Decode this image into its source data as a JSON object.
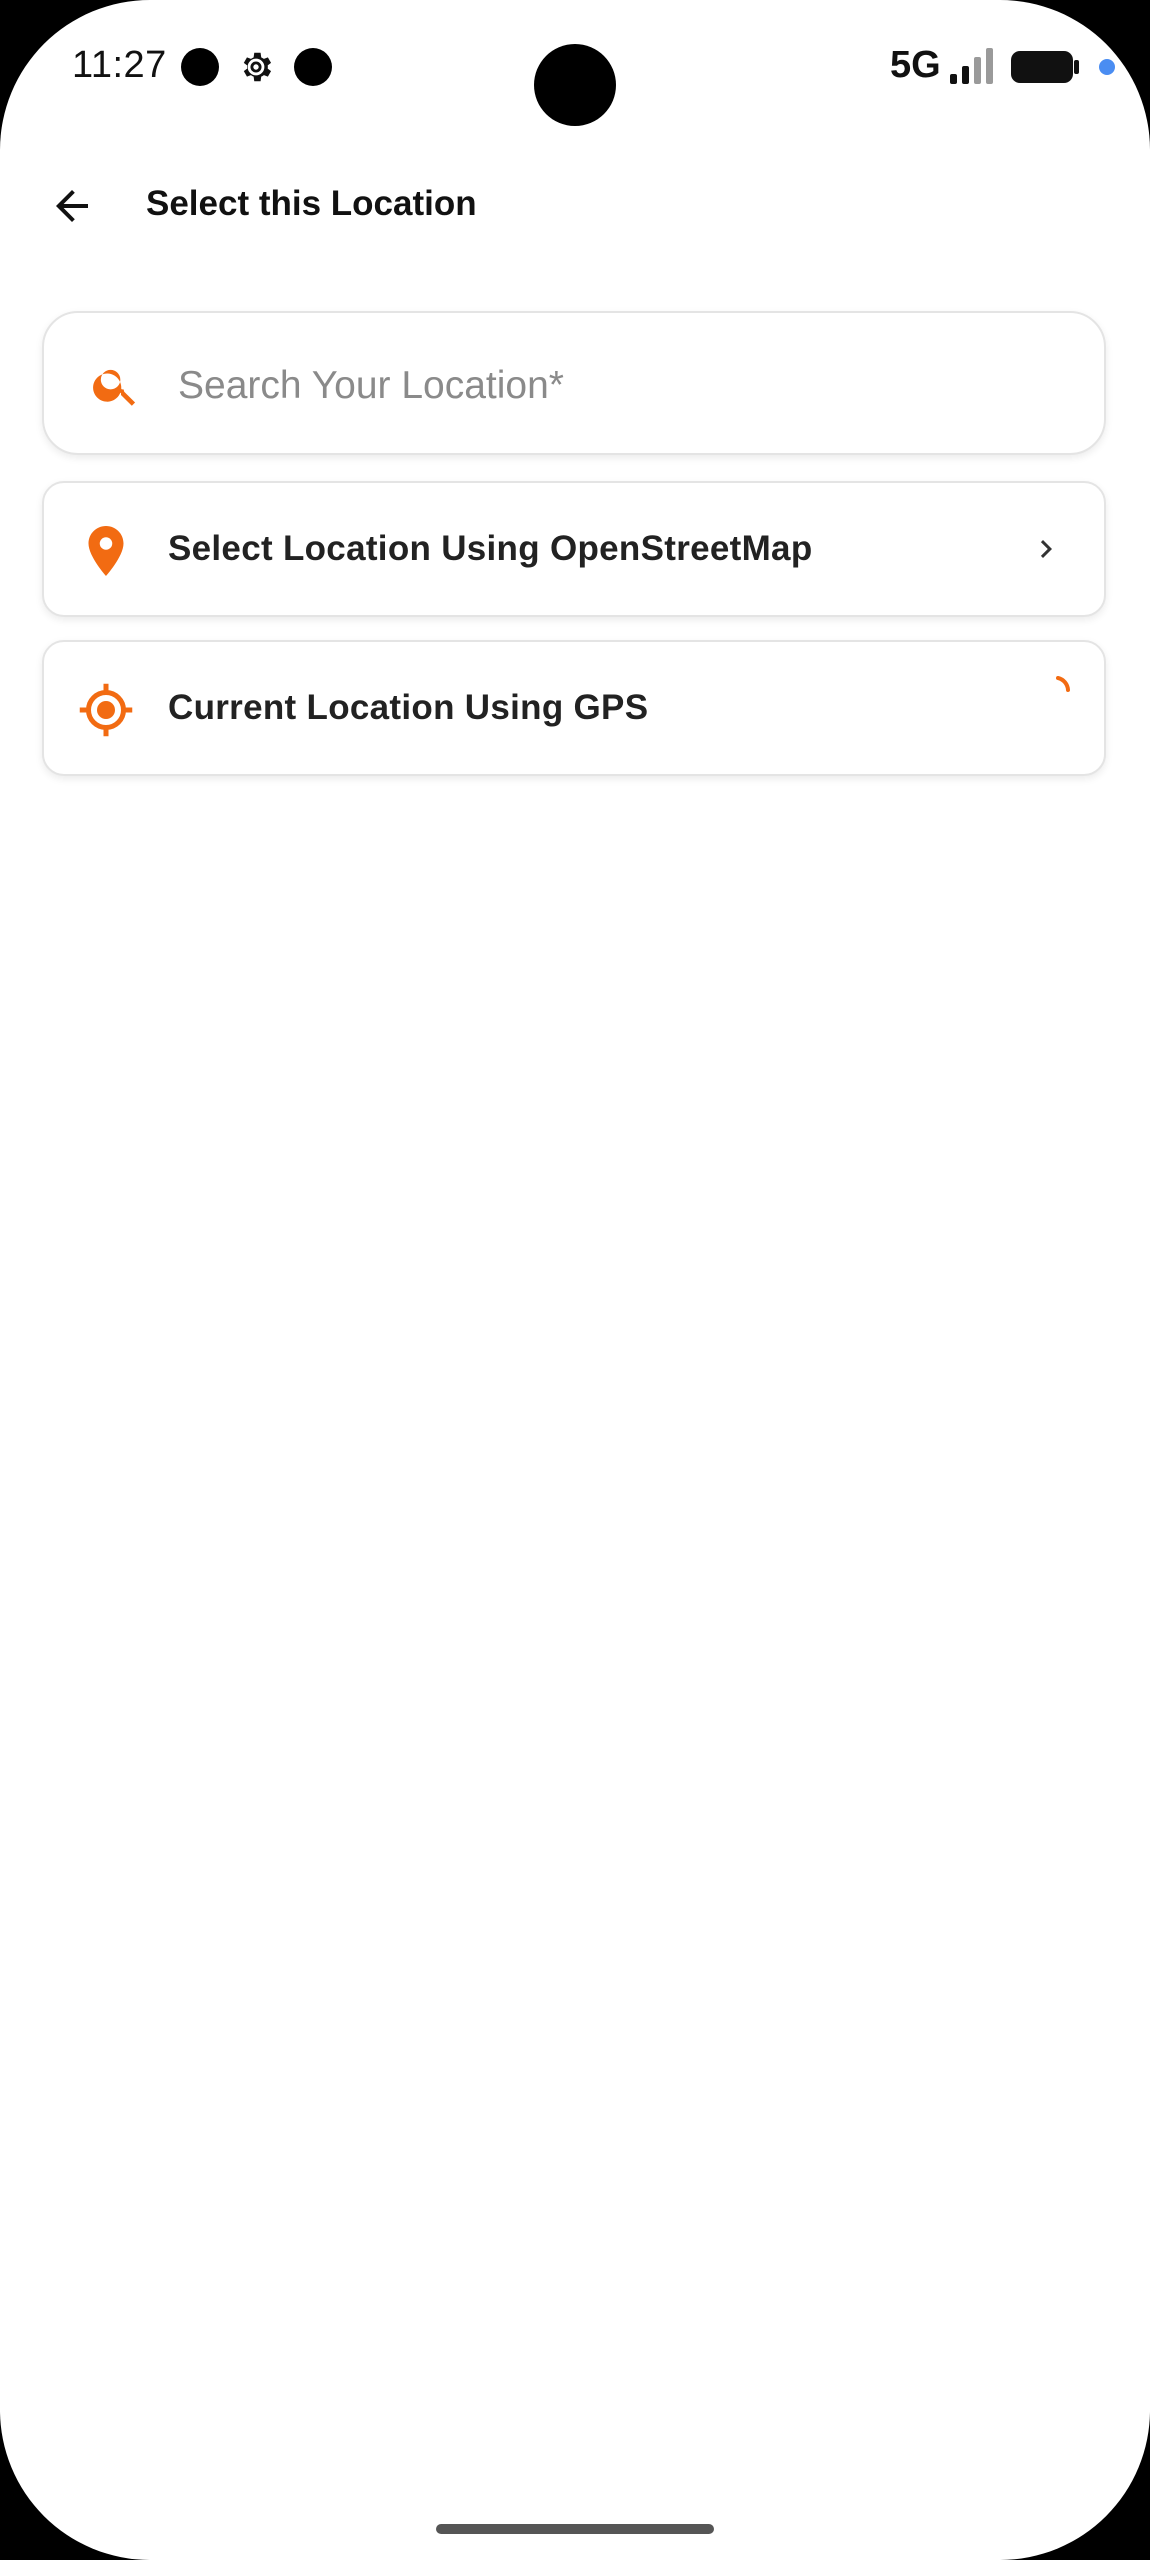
{
  "status_bar": {
    "time": "11:27",
    "network": "5G",
    "icons": [
      "notification-dot-icon",
      "settings-gear-icon",
      "notification-dot-icon",
      "signal-icon",
      "battery-icon"
    ]
  },
  "header": {
    "title": "Select this Location",
    "back_icon": "arrow-left-icon"
  },
  "search": {
    "placeholder": "Search Your Location*",
    "value": "",
    "icon": "search-icon"
  },
  "options": [
    {
      "label": "Select Location Using OpenStreetMap",
      "icon": "map-pin-icon",
      "trailing": "chevron-right-icon"
    },
    {
      "label": "Current Location Using GPS",
      "icon": "gps-target-icon",
      "trailing": "loading-spinner-icon"
    }
  ],
  "colors": {
    "accent": "#f26b12",
    "text": "#222222",
    "card_border": "#e4e4e4",
    "background": "#ffffff"
  }
}
